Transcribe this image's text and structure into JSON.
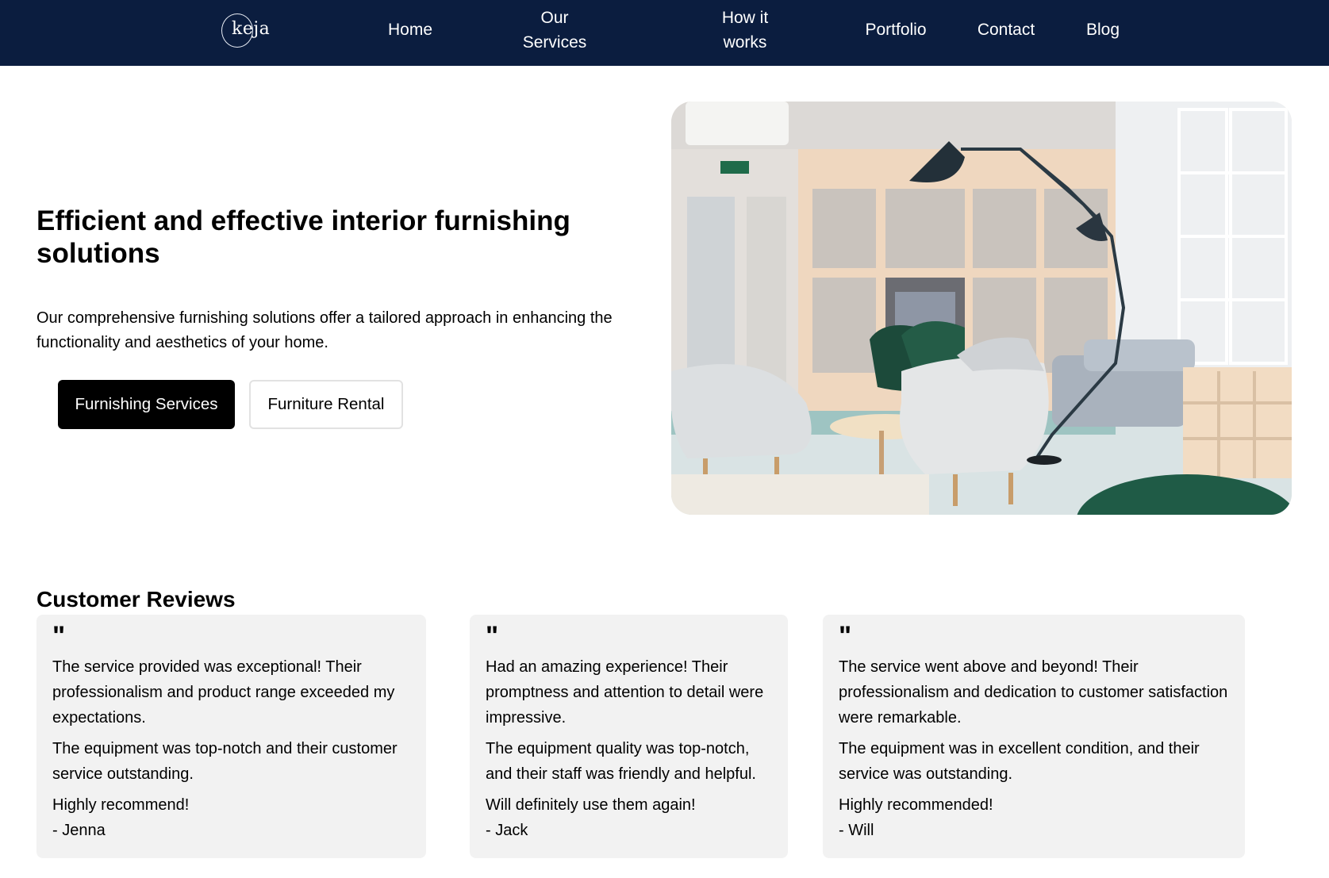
{
  "brand": {
    "logo_text": "keja"
  },
  "nav": {
    "home": "Home",
    "services": "Our Services",
    "how": "How it works",
    "portfolio": "Portfolio",
    "contact": "Contact",
    "blog": "Blog"
  },
  "hero": {
    "title": "Efficient and effective interior furnishing solutions",
    "description": "Our comprehensive furnishing solutions offer a tailored approach in enhancing the functionality and aesthetics of your home.",
    "primary_button": "Furnishing Services",
    "secondary_button": "Furniture Rental"
  },
  "reviews": {
    "title": "Customer Reviews",
    "quote_mark": "\"",
    "items": [
      {
        "p1": "The service provided was exceptional! Their professionalism and product range exceeded my expectations.",
        "p2": "The equipment was top-notch and their customer service outstanding.",
        "p3": "Highly recommend!",
        "author": "- Jenna"
      },
      {
        "p1": "Had an amazing experience! Their promptness and attention to detail were impressive.",
        "p2": "The equipment quality was top-notch, and their staff was friendly and helpful.",
        "p3": "Will definitely use them again!",
        "author": "- Jack"
      },
      {
        "p1": "The service went above and beyond! Their professionalism and dedication to customer satisfaction were remarkable.",
        "p2": "The equipment was in excellent condition, and their service was outstanding.",
        "p3": "Highly recommended!",
        "author": "- Will"
      }
    ]
  },
  "colors": {
    "nav_background": "#0b1d3f",
    "primary_button": "#000000",
    "card_background": "#f2f2f2"
  }
}
